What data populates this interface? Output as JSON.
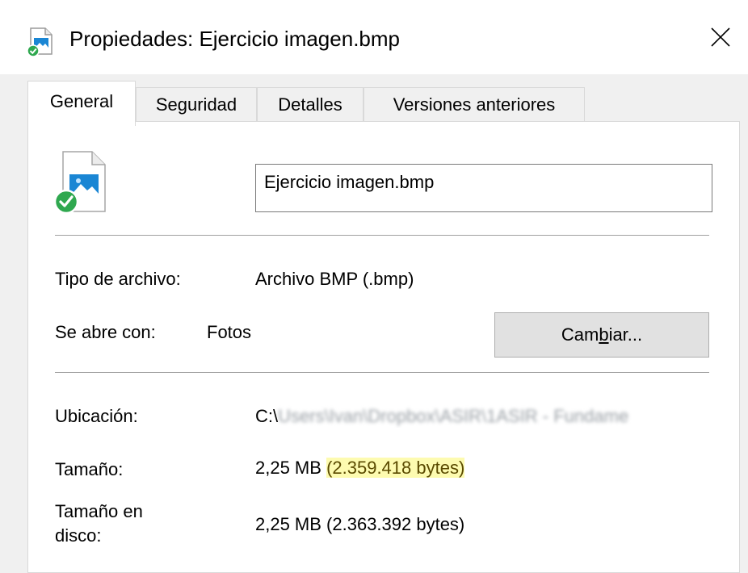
{
  "window": {
    "title": "Propiedades: Ejercicio imagen.bmp",
    "close_symbol": "✕"
  },
  "tabs": [
    {
      "label": "General",
      "active": true
    },
    {
      "label": "Seguridad",
      "active": false
    },
    {
      "label": "Detalles",
      "active": false
    },
    {
      "label": "Versiones anteriores",
      "active": false
    }
  ],
  "general": {
    "file_name": "Ejercicio imagen.bmp",
    "file_type_label": "Tipo de archivo:",
    "file_type_value": "Archivo BMP (.bmp)",
    "opens_with_label": "Se abre con:",
    "opens_with_value": "Fotos",
    "change_button": {
      "pre": "Cam",
      "accel": "b",
      "post": "iar..."
    },
    "location_label": "Ubicación:",
    "location_prefix": "C:\\",
    "location_rest": "Users\\Ivan\\Dropbox\\ASIR\\1ASIR - Fundame",
    "size_label": "Tamaño:",
    "size_value": "2,25 MB",
    "size_bytes": "(2.359.418 bytes)",
    "size_on_disk_label_line1": "Tamaño en",
    "size_on_disk_label_line2": "disco:",
    "size_on_disk_value": "2,25 MB (2.363.392 bytes)"
  },
  "colors": {
    "highlight": "#fdfbb0",
    "icon_blue": "#1a86d4",
    "check_green": "#2fa84f"
  },
  "icons": [
    "bmp-file-icon",
    "sync-check-icon",
    "close-icon"
  ]
}
